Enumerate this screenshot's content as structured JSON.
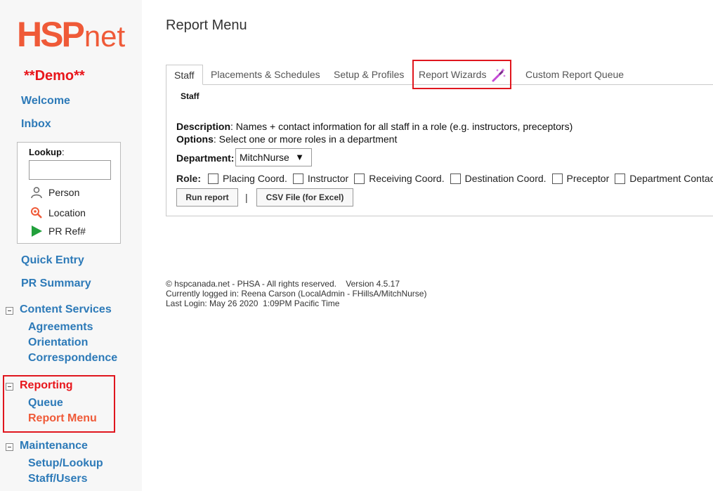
{
  "logo": {
    "hsp": "HSP",
    "net": "net"
  },
  "demo_label": "**Demo**",
  "nav": {
    "welcome": "Welcome",
    "inbox": "Inbox",
    "quick_entry": "Quick Entry",
    "pr_summary": "PR Summary"
  },
  "lookup": {
    "label": "Lookup",
    "colon": ":",
    "input_value": "",
    "person": "Person",
    "location": "Location",
    "pr_ref": "PR Ref#"
  },
  "content_services": {
    "label": "Content Services",
    "items": [
      "Agreements",
      "Orientation",
      "Correspondence"
    ]
  },
  "reporting": {
    "label": "Reporting",
    "items": [
      "Queue",
      "Report Menu"
    ]
  },
  "maintenance": {
    "label": "Maintenance",
    "items": [
      "Setup/Lookup",
      "Staff/Users"
    ]
  },
  "page_title": "Report Menu",
  "tabs": [
    "Staff",
    "Placements & Schedules",
    "Setup & Profiles",
    "Report Wizards",
    "Custom Report Queue"
  ],
  "active_tab": "Staff",
  "panel": {
    "title": "Staff",
    "description_label": "Description",
    "description_text": ": Names + contact information for all staff in a role (e.g. instructors, preceptors)",
    "options_label": "Options",
    "options_text": ": Select one or more roles in a department",
    "department_label": "Department",
    "department_colon": ":",
    "department_value": "MitchNurse",
    "role_label": "Role",
    "role_colon": ":",
    "roles": [
      "Placing Coord.",
      "Instructor",
      "Receiving Coord.",
      "Destination Coord.",
      "Preceptor",
      "Department Contact"
    ],
    "run_report": "Run report",
    "separator": "|",
    "csv_button": "CSV File (for Excel)"
  },
  "footer": {
    "line1": "© hspcanada.net - PHSA - All rights reserved.    Version 4.5.17",
    "line2": "Currently logged in: Reena Carson (LocalAdmin - FHillsA/MitchNurse)",
    "line3": "Last Login: May 26 2020  1:09PM Pacific Time"
  },
  "colors": {
    "brand": "#ef5a38",
    "link": "#2d7ab8",
    "active_link": "#ef5a38",
    "demo": "#e8161b",
    "highlight": "#e0161e",
    "sidebar_bg": "#f7f7f7"
  }
}
